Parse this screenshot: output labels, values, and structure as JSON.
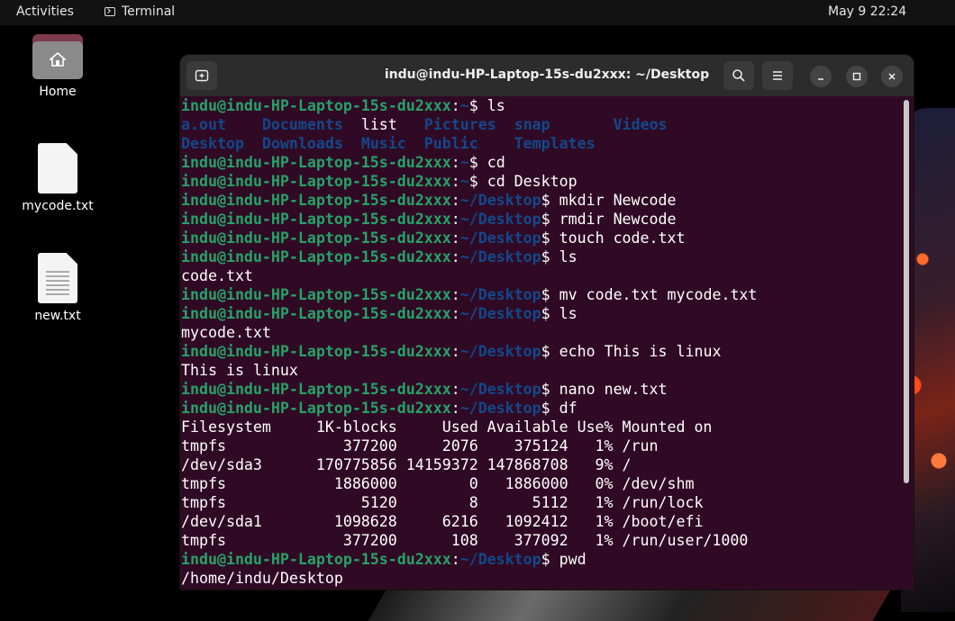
{
  "topbar": {
    "activities": "Activities",
    "app_name": "Terminal",
    "clock": "May 9  22:24"
  },
  "desktop": {
    "icons": [
      {
        "label": "Home"
      },
      {
        "label": "mycode.txt"
      },
      {
        "label": "new.txt"
      }
    ]
  },
  "window": {
    "title": "indu@indu-HP-Laptop-15s-du2xxx: ~/Desktop",
    "icons": [
      "new-tab-icon",
      "search-icon",
      "menu-icon",
      "minimize-icon",
      "maximize-icon",
      "close-icon"
    ]
  },
  "terminal": {
    "user": "indu@indu-HP-Laptop-15s-du2xxx",
    "lines": [
      {
        "type": "prompt",
        "path": "~",
        "cmd": "ls"
      },
      {
        "type": "ls",
        "items": [
          [
            "a.out",
            "dir"
          ],
          [
            "    ",
            ""
          ],
          [
            "Documents",
            "dir"
          ],
          [
            "  ",
            ""
          ],
          [
            "list",
            "plain"
          ],
          [
            "   ",
            ""
          ],
          [
            "Pictures",
            "dir"
          ],
          [
            "  ",
            ""
          ],
          [
            "snap",
            "dir"
          ],
          [
            "       ",
            ""
          ],
          [
            "Videos",
            "dir"
          ]
        ]
      },
      {
        "type": "ls",
        "items": [
          [
            "Desktop",
            "dir"
          ],
          [
            "  ",
            ""
          ],
          [
            "Downloads",
            "dir"
          ],
          [
            "  ",
            ""
          ],
          [
            "Music",
            "dir"
          ],
          [
            "  ",
            ""
          ],
          [
            "Public",
            "dir"
          ],
          [
            "    ",
            ""
          ],
          [
            "Templates",
            "dir"
          ]
        ]
      },
      {
        "type": "prompt",
        "path": "~",
        "cmd": "cd"
      },
      {
        "type": "prompt",
        "path": "~",
        "cmd": "cd Desktop"
      },
      {
        "type": "prompt",
        "path": "~/Desktop",
        "cmd": "mkdir Newcode"
      },
      {
        "type": "prompt",
        "path": "~/Desktop",
        "cmd": "rmdir Newcode"
      },
      {
        "type": "prompt",
        "path": "~/Desktop",
        "cmd": "touch code.txt"
      },
      {
        "type": "prompt",
        "path": "~/Desktop",
        "cmd": "ls"
      },
      {
        "type": "out",
        "text": "code.txt"
      },
      {
        "type": "prompt",
        "path": "~/Desktop",
        "cmd": "mv code.txt mycode.txt"
      },
      {
        "type": "prompt",
        "path": "~/Desktop",
        "cmd": "ls"
      },
      {
        "type": "out",
        "text": "mycode.txt"
      },
      {
        "type": "prompt",
        "path": "~/Desktop",
        "cmd": "echo This is linux"
      },
      {
        "type": "out",
        "text": "This is linux"
      },
      {
        "type": "prompt",
        "path": "~/Desktop",
        "cmd": "nano new.txt"
      },
      {
        "type": "prompt",
        "path": "~/Desktop",
        "cmd": "df"
      },
      {
        "type": "out",
        "text": "Filesystem     1K-blocks     Used Available Use% Mounted on"
      },
      {
        "type": "out",
        "text": "tmpfs             377200     2076    375124   1% /run"
      },
      {
        "type": "out",
        "text": "/dev/sda3      170775856 14159372 147868708   9% /"
      },
      {
        "type": "out",
        "text": "tmpfs            1886000        0   1886000   0% /dev/shm"
      },
      {
        "type": "out",
        "text": "tmpfs               5120        8      5112   1% /run/lock"
      },
      {
        "type": "out",
        "text": "/dev/sda1        1098628     6216   1092412   1% /boot/efi"
      },
      {
        "type": "out",
        "text": "tmpfs             377200      108    377092   1% /run/user/1000"
      },
      {
        "type": "prompt",
        "path": "~/Desktop",
        "cmd": "pwd"
      },
      {
        "type": "out",
        "text": "/home/indu/Desktop"
      }
    ]
  }
}
